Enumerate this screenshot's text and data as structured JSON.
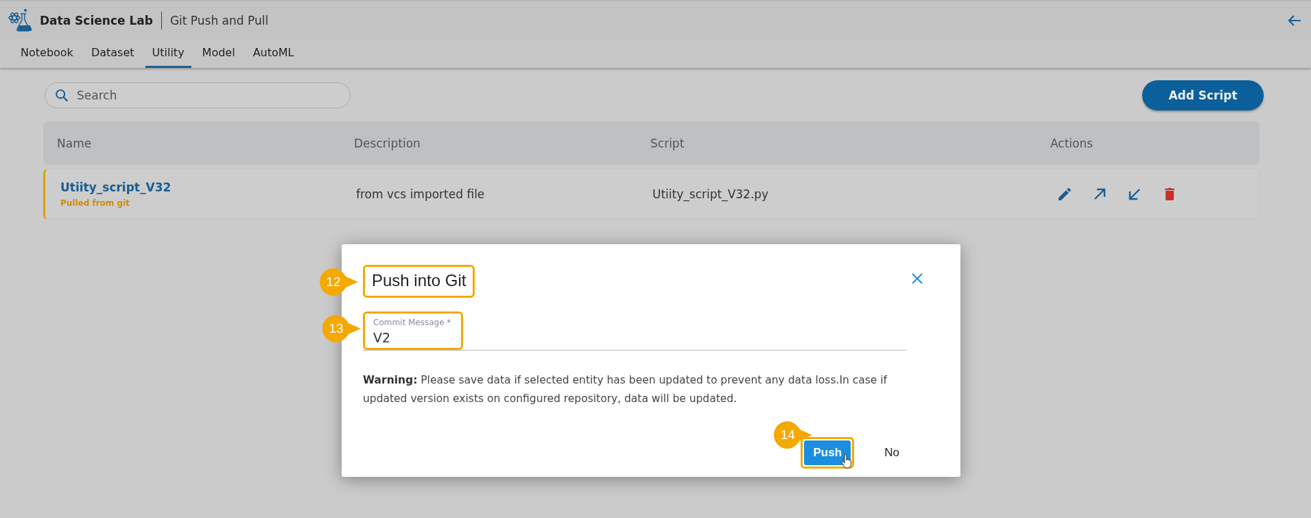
{
  "header": {
    "app_title": "Data Science Lab",
    "page_title": "Git Push and Pull"
  },
  "tabs": [
    {
      "label": "Notebook",
      "selected": false
    },
    {
      "label": "Dataset",
      "selected": false
    },
    {
      "label": "Utility",
      "selected": true
    },
    {
      "label": "Model",
      "selected": false
    },
    {
      "label": "AutoML",
      "selected": false
    }
  ],
  "search": {
    "placeholder": "Search"
  },
  "add_button": "Add Script",
  "table": {
    "columns": [
      "Name",
      "Description",
      "Script",
      "Actions"
    ],
    "rows": [
      {
        "name": "Utiity_script_V32",
        "status": "Pulled from git",
        "description": "from vcs imported file",
        "script": "Utiity_script_V32.py",
        "actions": [
          {
            "kind": "edit"
          },
          {
            "kind": "push"
          },
          {
            "kind": "pull"
          },
          {
            "kind": "delete"
          }
        ]
      }
    ]
  },
  "dialog": {
    "title": "Push into Git",
    "title_callout": "12",
    "field": {
      "label": "Commit Message *",
      "value": "V2",
      "callout": "13"
    },
    "warning": "**Warning:** Please save data if selected entity has been updated to prevent any data loss.In case if updated version exists on configured repository, data will be updated.",
    "buttons": [
      {
        "label": "Push",
        "kind": "primary",
        "callout": "14"
      },
      {
        "label": "No",
        "kind": "text"
      }
    ]
  }
}
